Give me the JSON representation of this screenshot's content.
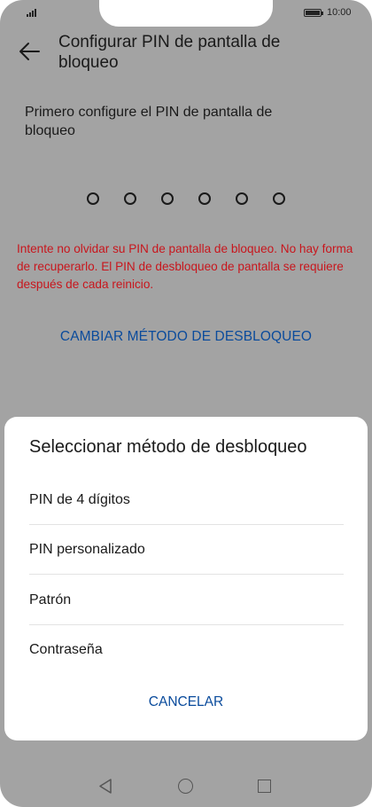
{
  "status_bar": {
    "time": "10:00",
    "signal_icon": "signal-icon",
    "battery_icon": "battery-icon"
  },
  "header": {
    "back_icon": "arrow-left-icon",
    "title": "Configurar PIN de pantalla de bloqueo"
  },
  "main": {
    "instruction": "Primero configure el PIN de pantalla de bloqueo",
    "pin_length_shown": 6,
    "warning": "Intente no olvidar su PIN de pantalla de bloqueo. No hay forma de recuperarlo. El PIN de desbloqueo de pantalla se requiere después de cada reinicio.",
    "change_method_label": "CAMBIAR MÉTODO DE DESBLOQUEO"
  },
  "sheet": {
    "title": "Seleccionar método de desbloqueo",
    "options": [
      {
        "label": "PIN de 4 dígitos"
      },
      {
        "label": "PIN personalizado"
      },
      {
        "label": "Patrón"
      },
      {
        "label": "Contraseña"
      }
    ],
    "cancel_label": "CANCELAR"
  },
  "nav_bar": {
    "back_icon": "triangle-back-icon",
    "home_icon": "circle-home-icon",
    "recent_icon": "square-recent-icon"
  },
  "colors": {
    "accent": "#0a4b9c",
    "warning": "#c8161d",
    "dim_background": "#a3a3a3"
  }
}
